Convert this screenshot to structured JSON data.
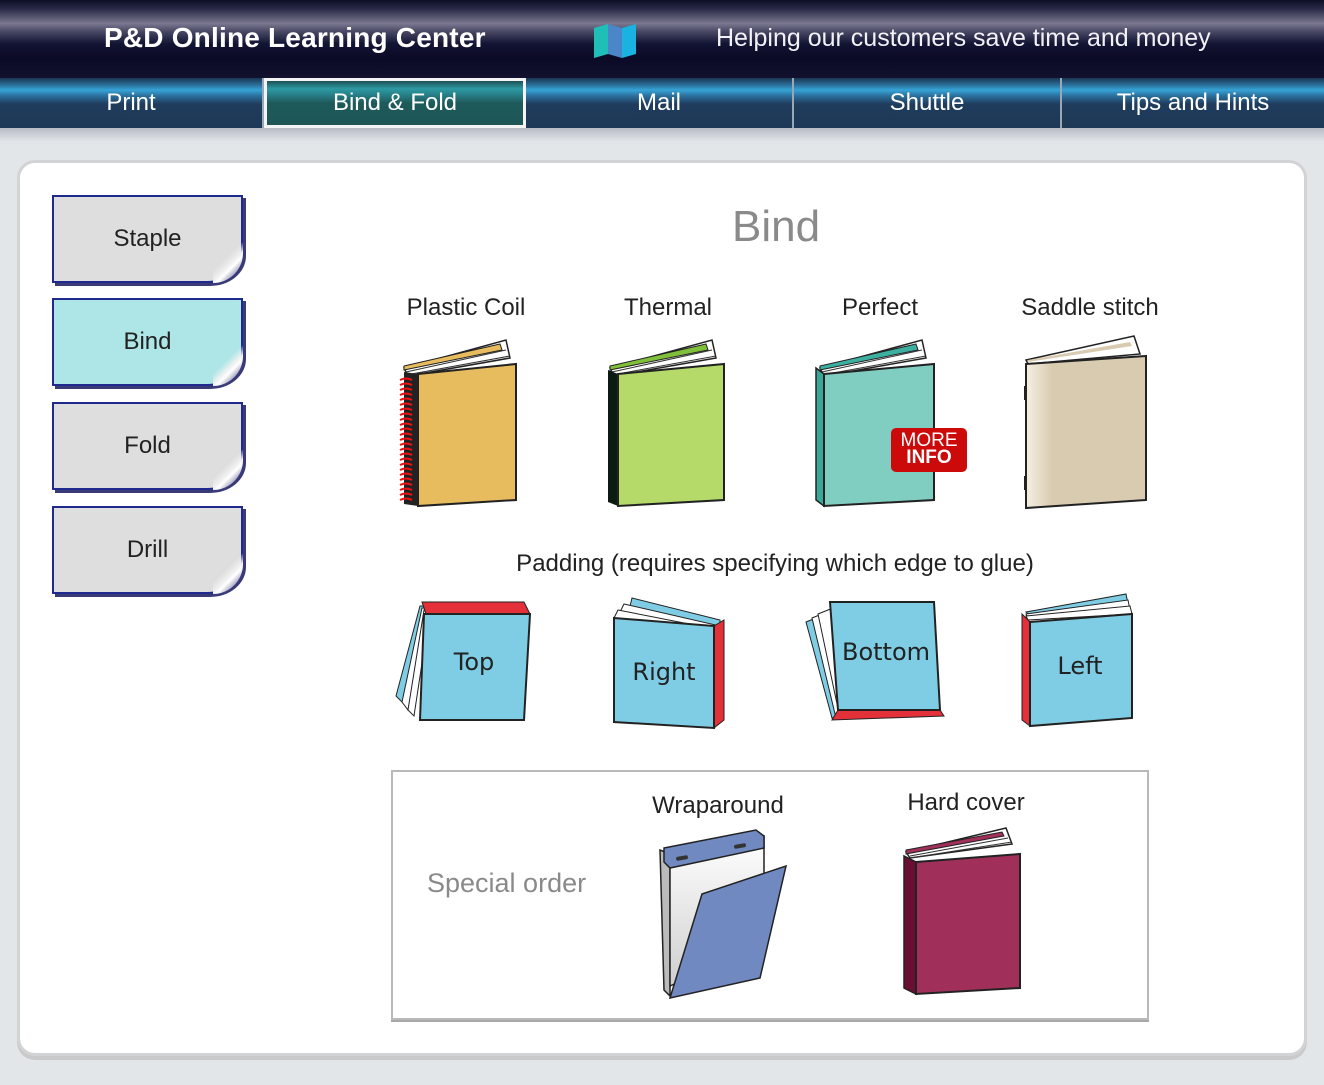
{
  "header": {
    "title": "P&D Online Learning Center",
    "tagline": "Helping our customers save time and money",
    "logo_icon": "folded-map-icon"
  },
  "nav": {
    "tabs": [
      {
        "label": "Print",
        "active": false
      },
      {
        "label": "Bind & Fold",
        "active": true
      },
      {
        "label": "Mail",
        "active": false
      },
      {
        "label": "Shuttle",
        "active": false
      },
      {
        "label": "Tips and Hints",
        "active": false
      }
    ]
  },
  "sidebar": {
    "items": [
      {
        "label": "Staple",
        "active": false
      },
      {
        "label": "Bind",
        "active": true
      },
      {
        "label": "Fold",
        "active": false
      },
      {
        "label": "Drill",
        "active": false
      }
    ]
  },
  "main": {
    "title": "Bind",
    "bindings": [
      {
        "label": "Plastic Coil",
        "color": "#e6bc5e",
        "icon": "plastic-coil-book-icon"
      },
      {
        "label": "Thermal",
        "color": "#b5da6a",
        "icon": "thermal-book-icon"
      },
      {
        "label": "Perfect",
        "color": "#80cdc1",
        "icon": "perfect-bound-book-icon"
      },
      {
        "label": "Saddle stitch",
        "color": "#d8cbb0",
        "icon": "saddle-stitch-book-icon"
      }
    ],
    "more_info": {
      "line1": "MORE",
      "line2": "INFO"
    },
    "padding": {
      "title": "Padding (requires specifying which edge to glue)",
      "items": [
        {
          "label": "Top"
        },
        {
          "label": "Right"
        },
        {
          "label": "Bottom"
        },
        {
          "label": "Left"
        }
      ],
      "pad_color": "#7fcde4",
      "glue_color": "#e33039"
    },
    "special_order": {
      "label": "Special order",
      "items": [
        {
          "label": "Wraparound",
          "color": "#7089c0",
          "icon": "wraparound-binder-icon"
        },
        {
          "label": "Hard cover",
          "color": "#a0305a",
          "icon": "hard-cover-book-icon"
        }
      ]
    }
  }
}
